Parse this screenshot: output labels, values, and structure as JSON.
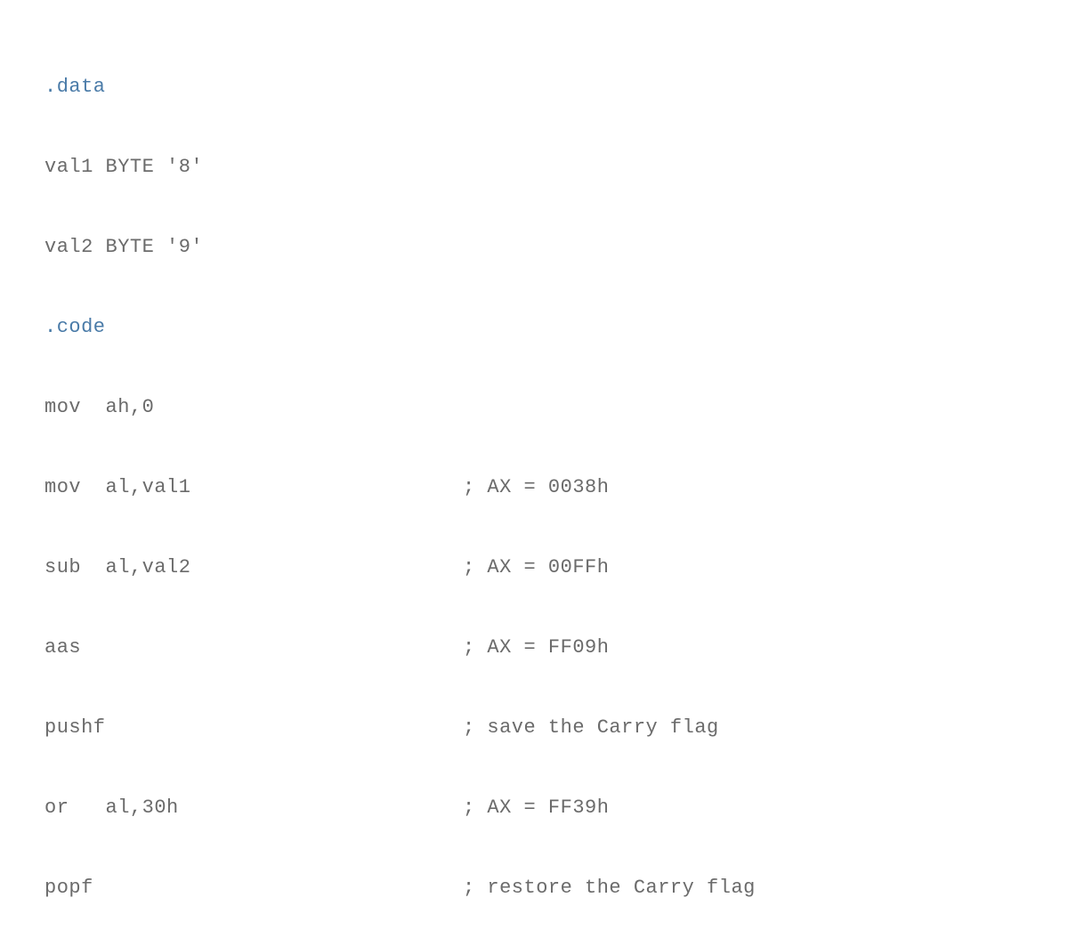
{
  "code": {
    "lines": [
      {
        "instr_pre_dir": "",
        "directive": ".data",
        "instr_post_dir": "",
        "comment": ""
      },
      {
        "instr_pre_dir": "val1 BYTE '8'",
        "directive": "",
        "instr_post_dir": "",
        "comment": ""
      },
      {
        "instr_pre_dir": "val2 BYTE '9'",
        "directive": "",
        "instr_post_dir": "",
        "comment": ""
      },
      {
        "instr_pre_dir": "",
        "directive": ".code",
        "instr_post_dir": "",
        "comment": ""
      },
      {
        "instr_pre_dir": "mov  ah,0",
        "directive": "",
        "instr_post_dir": "",
        "comment": ""
      },
      {
        "instr_pre_dir": "mov  al,val1",
        "directive": "",
        "instr_post_dir": "",
        "comment": "; AX = 0038h"
      },
      {
        "instr_pre_dir": "sub  al,val2",
        "directive": "",
        "instr_post_dir": "",
        "comment": "; AX = 00FFh"
      },
      {
        "instr_pre_dir": "aas",
        "directive": "",
        "instr_post_dir": "",
        "comment": "; AX = FF09h"
      },
      {
        "instr_pre_dir": "pushf",
        "directive": "",
        "instr_post_dir": "",
        "comment": "; save the Carry flag"
      },
      {
        "instr_pre_dir": "or   al,30h",
        "directive": "",
        "instr_post_dir": "",
        "comment": "; AX = FF39h"
      },
      {
        "instr_pre_dir": "popf",
        "directive": "",
        "instr_post_dir": "",
        "comment": "; restore the Carry flag"
      }
    ]
  }
}
